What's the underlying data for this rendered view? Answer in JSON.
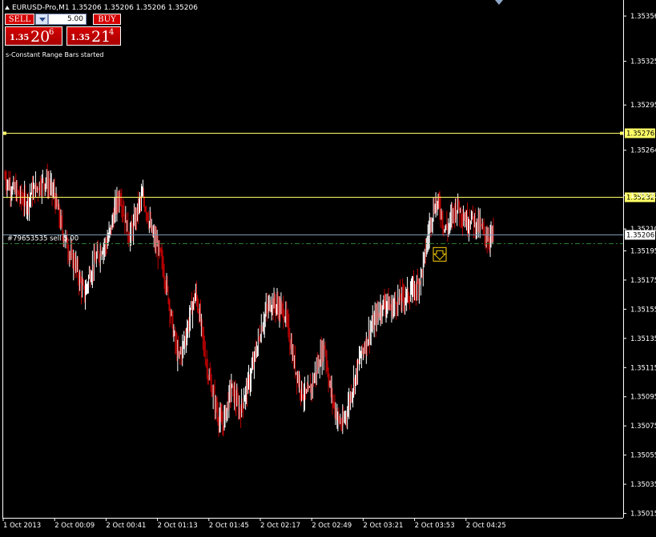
{
  "title": "EURUSD-Pro,M1  1.35206 1.35206 1.35206 1.35206",
  "trade_panel": {
    "sell_label": "SELL",
    "buy_label": "BUY",
    "lot_value": "5.00",
    "sell_price": {
      "prefix": "1.35",
      "big": "20",
      "sup": "6"
    },
    "buy_price": {
      "prefix": "1.35",
      "big": "21",
      "sup": "4"
    }
  },
  "status_message": "s-Constant Range Bars started",
  "colors": {
    "background": "#000000",
    "up_bar": "#ffffff",
    "down_bar": "#c00000",
    "hline": "#ffff66",
    "bid_line": "#7a9ab5",
    "order_line": "#2e7d32",
    "axis": "#ffffff"
  },
  "chart_data": {
    "type": "bar",
    "symbol": "EURUSD-Pro",
    "timeframe": "M1",
    "ylim": [
      1.35012,
      1.35367
    ],
    "yticks": [
      "1.35356",
      "1.35325",
      "1.35295",
      "1.35264",
      "1.35233",
      "1.35210",
      "1.35195",
      "1.35175",
      "1.35155",
      "1.35135",
      "1.35115",
      "1.35095",
      "1.35075",
      "1.35055",
      "1.35035",
      "1.35015"
    ],
    "yticks_values": [
      1.35356,
      1.35325,
      1.35295,
      1.35264,
      1.35233,
      1.3521,
      1.35195,
      1.35175,
      1.35155,
      1.35135,
      1.35115,
      1.35095,
      1.35075,
      1.35055,
      1.35035,
      1.35015
    ],
    "xticks": [
      "1 Oct 2013",
      "2 Oct 00:09",
      "2 Oct 00:41",
      "2 Oct 01:13",
      "2 Oct 01:45",
      "2 Oct 02:17",
      "2 Oct 02:49",
      "2 Oct 03:21",
      "2 Oct 03:53",
      "2 Oct 04:25"
    ],
    "horizontal_lines": [
      {
        "price": 1.35276,
        "label": "1.35276",
        "style": "solid"
      },
      {
        "price": 1.35232,
        "label": "1.35232",
        "style": "solid"
      }
    ],
    "bid_line": {
      "price": 1.35206,
      "label": "1.35206"
    },
    "order_line": {
      "price": 1.352,
      "label": "#79653535 sell 5.00"
    },
    "sell_arrow_price": 1.35194,
    "close_series": [
      1.35245,
      1.3524,
      1.35237,
      1.35234,
      1.3523,
      1.35228,
      1.35235,
      1.35238,
      1.35241,
      1.35243,
      1.3524,
      1.35234,
      1.35222,
      1.35208,
      1.352,
      1.3519,
      1.35185,
      1.35173,
      1.35165,
      1.35178,
      1.35186,
      1.35192,
      1.35198,
      1.352,
      1.35212,
      1.35226,
      1.35234,
      1.35218,
      1.35205,
      1.35212,
      1.35225,
      1.35232,
      1.35222,
      1.35208,
      1.352,
      1.35192,
      1.35178,
      1.3516,
      1.35138,
      1.35122,
      1.35128,
      1.3514,
      1.35155,
      1.35165,
      1.35148,
      1.35125,
      1.35108,
      1.35095,
      1.35082,
      1.35075,
      1.35088,
      1.35102,
      1.35092,
      1.35085,
      1.35096,
      1.35105,
      1.35118,
      1.35132,
      1.35145,
      1.35155,
      1.3516,
      1.35158,
      1.35155,
      1.35153,
      1.35138,
      1.3512,
      1.35108,
      1.35098,
      1.35095,
      1.35102,
      1.35112,
      1.35122,
      1.3513,
      1.35105,
      1.3509,
      1.3508,
      1.35075,
      1.35085,
      1.35098,
      1.3511,
      1.35122,
      1.3513,
      1.35138,
      1.35145,
      1.35152,
      1.35158,
      1.3516,
      1.35155,
      1.3516,
      1.35162,
      1.35164,
      1.35165,
      1.35168,
      1.35172,
      1.35182,
      1.352,
      1.35218,
      1.35228,
      1.35225,
      1.3521,
      1.35212,
      1.35222,
      1.35226,
      1.3522,
      1.35215,
      1.35218,
      1.35214,
      1.35212,
      1.35206,
      1.35204,
      1.35206
    ]
  }
}
